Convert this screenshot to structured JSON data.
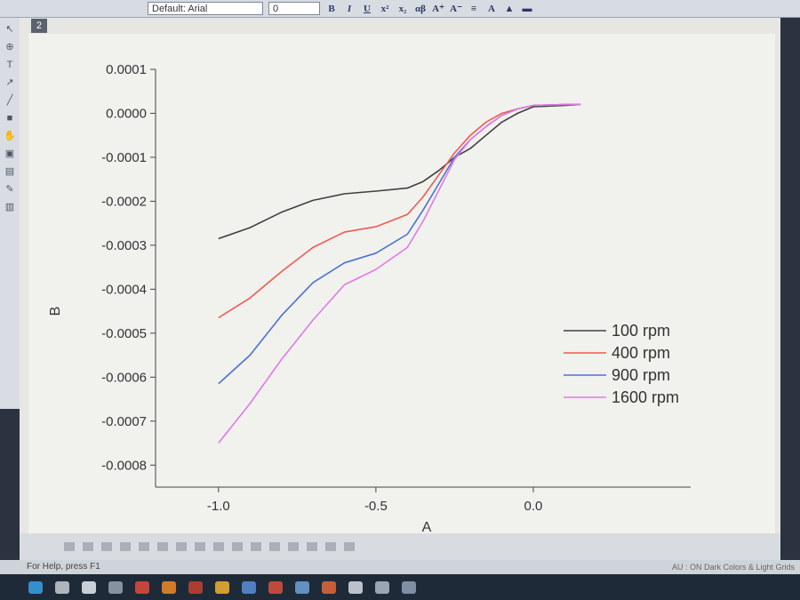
{
  "toolbar": {
    "font_name": "Default: Arial",
    "font_size": "0",
    "bold": "B",
    "italic": "I",
    "underline": "U",
    "greek": "αβ"
  },
  "window_tag": "2",
  "status_text": "For Help, press F1",
  "status_right": "AU : ON  Dark Colors & Light Grids",
  "chart_data": {
    "type": "line",
    "xlabel": "A",
    "ylabel": "B",
    "xlim": [
      -1.2,
      0.5
    ],
    "ylim": [
      -0.00085,
      0.0001
    ],
    "x_ticks": [
      -1.0,
      -0.5,
      0.0
    ],
    "x_tick_labels": [
      "-1.0",
      "-0.5",
      "0.0"
    ],
    "y_ticks": [
      0.0001,
      0.0,
      -0.0001,
      -0.0002,
      -0.0003,
      -0.0004,
      -0.0005,
      -0.0006,
      -0.0007,
      -0.0008
    ],
    "y_tick_labels": [
      "0.0001",
      "0.0000",
      "-0.0001",
      "-0.0002",
      "-0.0003",
      "-0.0004",
      "-0.0005",
      "-0.0006",
      "-0.0007",
      "-0.0008"
    ],
    "grid": false,
    "legend_position": "right",
    "series": [
      {
        "name": "100 rpm",
        "color": "#404040",
        "x": [
          -1.0,
          -0.9,
          -0.8,
          -0.7,
          -0.6,
          -0.5,
          -0.4,
          -0.35,
          -0.3,
          -0.25,
          -0.2,
          -0.15,
          -0.1,
          -0.05,
          0.0,
          0.1,
          0.15
        ],
        "y": [
          -0.000285,
          -0.00026,
          -0.000225,
          -0.000198,
          -0.000183,
          -0.000177,
          -0.00017,
          -0.000155,
          -0.00013,
          -0.0001,
          -8e-05,
          -5e-05,
          -2e-05,
          0.0,
          1.5e-05,
          1.8e-05,
          2e-05
        ]
      },
      {
        "name": "400 rpm",
        "color": "#f05a50",
        "x": [
          -1.0,
          -0.9,
          -0.8,
          -0.7,
          -0.6,
          -0.5,
          -0.4,
          -0.35,
          -0.3,
          -0.25,
          -0.2,
          -0.15,
          -0.1,
          -0.05,
          0.0,
          0.1,
          0.15
        ],
        "y": [
          -0.000465,
          -0.00042,
          -0.00036,
          -0.000305,
          -0.00027,
          -0.000258,
          -0.00023,
          -0.00019,
          -0.00014,
          -9e-05,
          -5e-05,
          -2e-05,
          0.0,
          1e-05,
          1.8e-05,
          2e-05,
          2e-05
        ]
      },
      {
        "name": "900 rpm",
        "color": "#4a72d0",
        "x": [
          -1.0,
          -0.9,
          -0.8,
          -0.7,
          -0.6,
          -0.5,
          -0.4,
          -0.35,
          -0.3,
          -0.25,
          -0.2,
          -0.15,
          -0.1,
          -0.05,
          0.0,
          0.1,
          0.15
        ],
        "y": [
          -0.000615,
          -0.00055,
          -0.00046,
          -0.000385,
          -0.00034,
          -0.000318,
          -0.000275,
          -0.00022,
          -0.00016,
          -0.0001,
          -6e-05,
          -3e-05,
          -5e-06,
          1e-05,
          1.8e-05,
          2e-05,
          2e-05
        ]
      },
      {
        "name": "1600 rpm",
        "color": "#e07ae6",
        "x": [
          -1.0,
          -0.9,
          -0.8,
          -0.7,
          -0.6,
          -0.5,
          -0.4,
          -0.35,
          -0.3,
          -0.25,
          -0.2,
          -0.15,
          -0.1,
          -0.05,
          0.0,
          0.1,
          0.15
        ],
        "y": [
          -0.00075,
          -0.00066,
          -0.00056,
          -0.00047,
          -0.00039,
          -0.000355,
          -0.000305,
          -0.000245,
          -0.000175,
          -0.000105,
          -6e-05,
          -3e-05,
          -5e-06,
          1e-05,
          1.8e-05,
          2e-05,
          2e-05
        ]
      }
    ]
  }
}
